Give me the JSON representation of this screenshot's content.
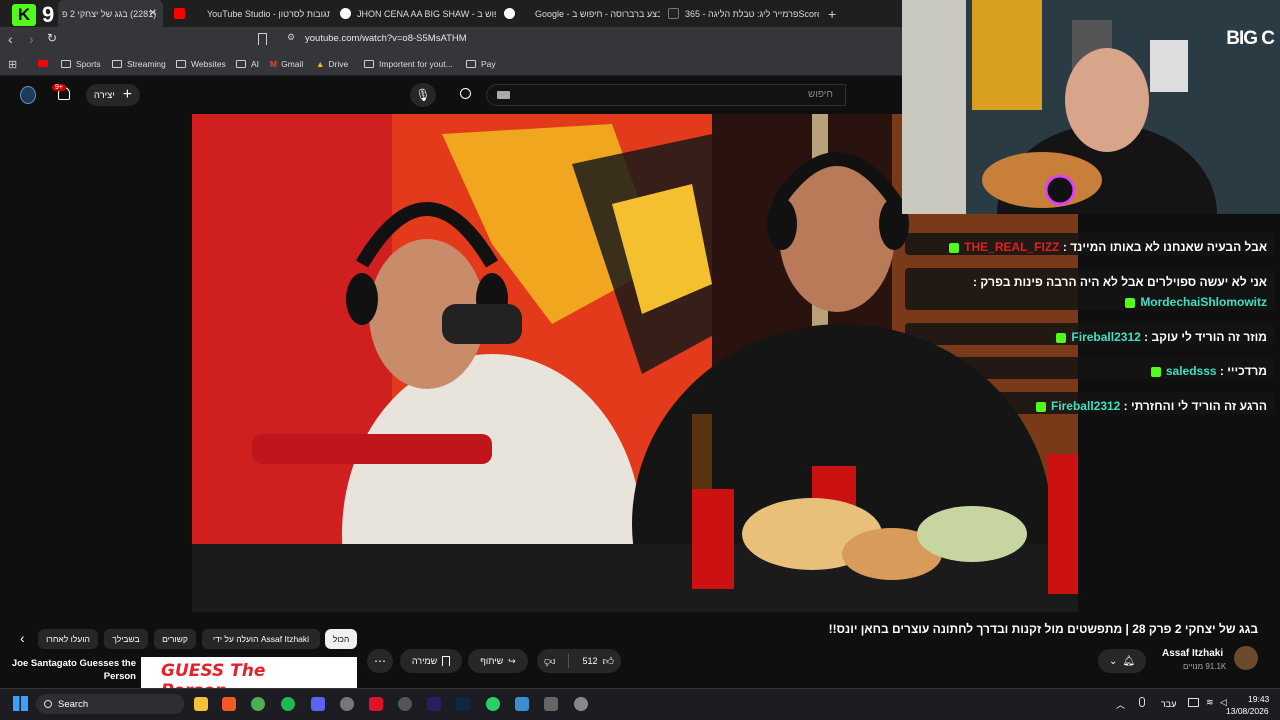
{
  "browser": {
    "tabs": [
      {
        "title": "(2281) בגג של יצחקי 2 פ",
        "active": true
      },
      {
        "title": "YouTube Studio - תגובות לסרטון"
      },
      {
        "title": "JHON CENA AA BIG SHAW - חיפוש ב"
      },
      {
        "title": "Google - מבצע ברברוסה - חיפוש ב"
      },
      {
        "title": "פרמייר ליג: טבלת הליגה - 365Scores"
      }
    ],
    "new_tab": "+",
    "kick_count": "9",
    "url": "youtube.com/watch?v=o8-S5MsATHM",
    "bookmarks": [
      "Sports",
      "Streaming",
      "Websites",
      "AI",
      "Gmail",
      "Drive",
      "Importent for yout...",
      "Pay"
    ]
  },
  "yt": {
    "create_label": "יצירה",
    "notif_badge": "9+",
    "search_placeholder": "חיפוש",
    "title": "בגג של יצחקי 2 פרק 28 | מתפשטים מול זקנות ובדרך לחתונה עוצרים בחאן יונס!!",
    "channel": "Assaf Itzhaki",
    "subscribers": "91.1K מנויים",
    "likes": "512",
    "share_label": "שיתוף",
    "save_label": "שמירה",
    "chips": [
      "הכול",
      "הועלה על ידי Assaf Itzhaki",
      "קשורים",
      "בשבילך",
      "הועלו לאחרו"
    ],
    "rec_title_line1": "Joe Santagato Guesses the",
    "rec_title_line2": "Person",
    "rec_thumb_text": "GUESS The Person"
  },
  "stream": {
    "logo": "BIG C",
    "chat": [
      {
        "user": "THE_REAL_FIZZ",
        "text": "אבל הבעיה שאנחנו לא באותו המיינד",
        "color": "#e02020"
      },
      {
        "user": "MordechaiShlomowitz",
        "text": "אני לא יעשה ספוילרים אבל לא היה הרבה פינות בפרק",
        "color": "#3ee0c0"
      },
      {
        "user": "Fireball2312",
        "text": "מוזר זה הוריד לי עוקב",
        "color": "#3ee0c0"
      },
      {
        "user": "saledsss",
        "text": "מרדכייי",
        "color": "#3ee0c0"
      },
      {
        "user": "Fireball2312",
        "text": "הרגע זה הוריד לי והחזרתי",
        "color": "#3ee0c0"
      }
    ]
  },
  "taskbar": {
    "search": "Search",
    "lang": "עבר",
    "time": "19:43",
    "date": "13/08/2026"
  }
}
